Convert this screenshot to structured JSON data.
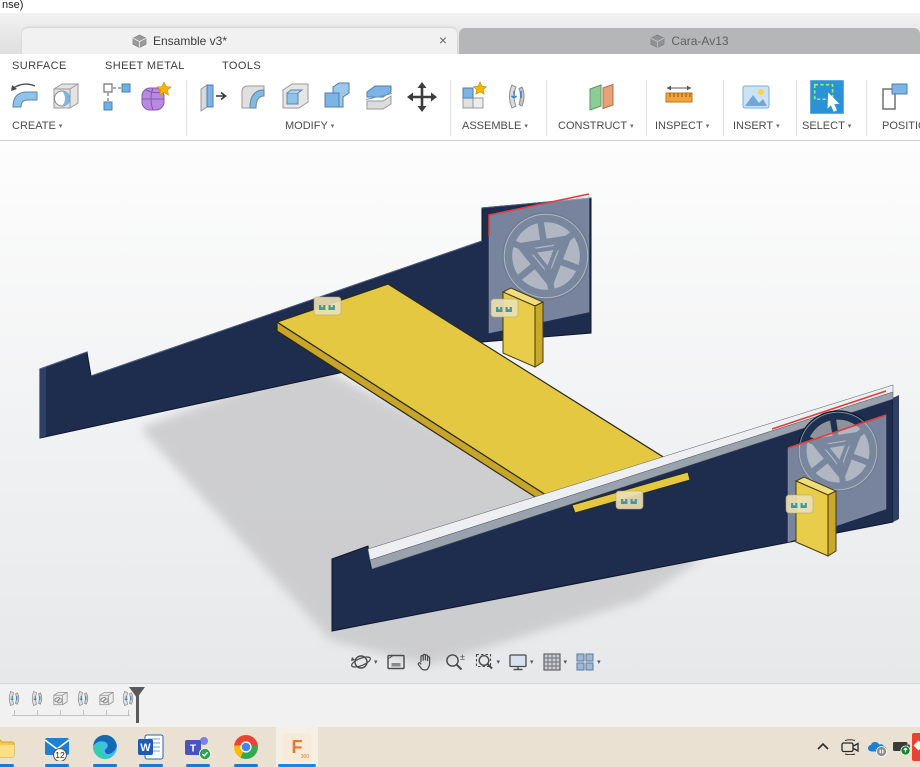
{
  "titlebar": {
    "fragment": "nse)"
  },
  "tabs": {
    "active": {
      "label": "Ensamble v3*",
      "close": "×"
    },
    "inactive": {
      "label": "Cara-Av13"
    }
  },
  "ribbon": {
    "tabs": {
      "surface": "SURFACE",
      "sheet_metal": "SHEET METAL",
      "tools": "TOOLS"
    },
    "caret": "▾",
    "groups": {
      "create": "CREATE",
      "modify": "MODIFY",
      "assemble": "ASSEMBLE",
      "construct": "CONSTRUCT",
      "inspect": "INSPECT",
      "insert": "INSERT",
      "select": "SELECT",
      "position": "POSITION"
    },
    "icon_names": {
      "create": [
        "flange-icon",
        "hole-icon",
        "pattern-icon",
        "create-form-icon"
      ],
      "modify": [
        "press-pull-icon",
        "fillet-icon",
        "shell-icon",
        "combine-icon",
        "split-body-icon",
        "move-copy-icon"
      ],
      "assemble": [
        "new-component-icon",
        "joint-icon"
      ],
      "construct": [
        "construction-plane-icon"
      ],
      "inspect": [
        "measure-icon"
      ],
      "insert": [
        "insert-image-icon"
      ],
      "select": [
        "select-icon"
      ],
      "position": [
        "position-icon"
      ]
    }
  },
  "viewport": {
    "nav_icons": [
      "orbit",
      "look-at",
      "pan",
      "zoom",
      "zoom-window",
      "display-settings",
      "grid-display",
      "viewports"
    ],
    "selection_outline_color": "#e23c3c",
    "model_colors": {
      "panel_navy": "#1e2c4e",
      "plate_yellow": "#e5c842",
      "reactor_gray": "#8e939b"
    }
  },
  "timeline": {
    "items": [
      "joint",
      "joint",
      "rigid-group",
      "joint",
      "rigid-group",
      "joint"
    ]
  },
  "taskbar": {
    "mail_badge": "12",
    "apps": [
      "file-explorer",
      "mail",
      "edge",
      "word",
      "teams",
      "chrome",
      "fusion-360"
    ],
    "tray": [
      "tray-expand",
      "meet-now",
      "onedrive",
      "display-status",
      "notification-edge"
    ]
  }
}
